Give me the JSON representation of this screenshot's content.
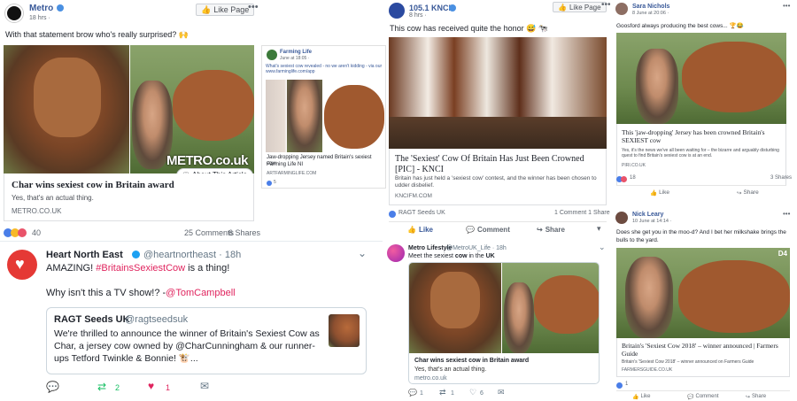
{
  "metro": {
    "name": "Metro",
    "time": "18 hrs ·",
    "like_page": "Like Page",
    "text": "With that statement brow who's really surprised? 🙌",
    "link_title": "Char wins sexiest cow in Britain award",
    "link_desc": "Yes, that's an actual thing.",
    "link_domain": "METRO.CO.UK",
    "watermark": "METRO.co.uk",
    "about": "About This Article",
    "reactions_count": "40",
    "comments": "25 Comments",
    "shares": "6 Shares"
  },
  "farming": {
    "name": "Farming Life",
    "meta": "June at 18:05 ·",
    "text": "What's sexiest cow revealed - no we aren't kidding - via our www.farminglife.com/app",
    "link_title": "Jaw-dropping Jersey named Britain's sexiest cow",
    "link_sub": "Farming Life NI",
    "link_domain": "ARTFARMINGLIFE.COM",
    "reaction": "5"
  },
  "kcni": {
    "name": "105.1 KNCI",
    "time": "8 hrs ·",
    "like_page": "Like Page",
    "text": "This cow has received quite the honor 😅 🐄",
    "link_title": "The 'Sexiest' Cow Of Britain Has Just Been Crowned [PIC] - KNCI",
    "link_desc": "Britain has just held a 'sexiest cow' contest, and the winner has been chosen to udder disbelief.",
    "link_domain": "KNCIFM.COM",
    "reactor": "RAGT Seeds UK",
    "comment_share": "1 Comment 1 Share",
    "like": "Like",
    "comment": "Comment",
    "share": "Share"
  },
  "sara": {
    "name": "Sara Nichols",
    "meta": "8 June at 20:06 ·",
    "text": "Goosford always producing the best cows... 🏆😂",
    "link_title": "This 'jaw-dropping' Jersey has been crowned Britain's SEXIEST cow",
    "link_desc": "Yes, it's the news we've all been waiting for – the bizarre and arguably disturbing quest to find Britain's sexiest cow is at an end.",
    "link_domain": "PIRI.CO.UK",
    "reaction_count": "18",
    "shares": "3 Shares",
    "like": "Like",
    "share": "Share"
  },
  "heart": {
    "name": "Heart North East",
    "handle": "@heartnortheast · 18h",
    "line1_prefix": "AMAZING! ",
    "hashtag": "#BritainsSexiestCow",
    "line1_suffix": " is a thing!",
    "line2_prefix": "Why isn't this a TV show!? -",
    "mention": "@TomCampbell",
    "quoted_name": "RAGT Seeds UK",
    "quoted_handle": "@ragtseedsuk",
    "quoted_text": "We're thrilled to announce the winner of Britain's Sexiest Cow as Char, a jersey cow owned by @CharCunningham & our runner-ups Tetford Twinkle & Bonnie! 🐮...",
    "retweets": "2",
    "likes": "1"
  },
  "metro_life": {
    "name": "Metro Lifestyle",
    "handle": "@MetroUK_Life · 18h",
    "text_prefix": "Meet the sexiest ",
    "text_cow": "cow",
    "text_mid": " in the ",
    "text_uk": "UK",
    "card_title": "Char wins sexiest cow in Britain award",
    "card_desc": "Yes, that's an actual thing.",
    "card_domain": "metro.co.uk",
    "replies": "1",
    "retweets": "1",
    "likes": "6"
  },
  "nick": {
    "name": "Nick Leary",
    "meta": "10 June at 14:14 ·",
    "text": "Does she get you in the moo-d? And I bet her milkshake brings the bulls to the yard.",
    "link_title": "Britain's 'Sexiest Cow 2018' – winner announced | Farmers Guide",
    "link_desc": "Britain's 'Sexiest Cow 2018' – winner announced on Farmers Guide",
    "link_domain": "FARMERSGUIDE.CO.UK",
    "reaction_count": "1",
    "like": "Like",
    "comment": "Comment",
    "share": "Share",
    "badge": "D4"
  },
  "colors": {
    "fb_blue": "#385898",
    "twitter_red": "#e0245e",
    "retweet_green": "#17bf63",
    "highlight": "#dbe5f6"
  }
}
